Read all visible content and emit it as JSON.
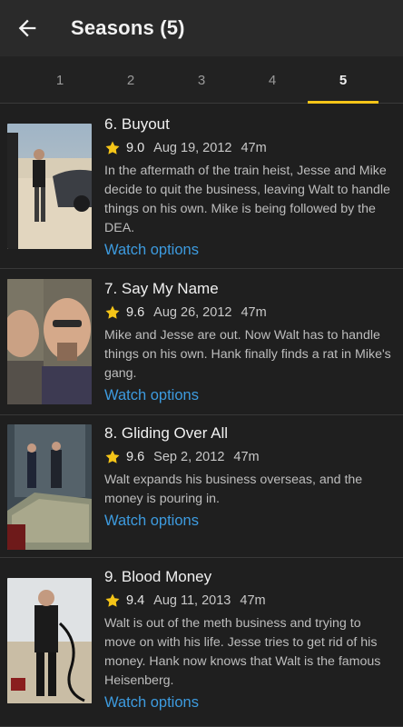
{
  "header": {
    "title": "Seasons (5)"
  },
  "tabs": [
    {
      "label": "1"
    },
    {
      "label": "2"
    },
    {
      "label": "3"
    },
    {
      "label": "4"
    },
    {
      "label": "5"
    }
  ],
  "active_tab": "5",
  "colors": {
    "accent": "#f5c518",
    "link": "#3d9bdf",
    "background": "#1f1f1f"
  },
  "episodes": [
    {
      "title": "6. Buyout",
      "rating": "9.0",
      "date": "Aug 19, 2012",
      "runtime": "47m",
      "description": "In the aftermath of the train heist, Jesse and Mike decide to quit the business, leaving Walt to handle things on his own. Mike is being followed by the DEA.",
      "watch_label": "Watch options"
    },
    {
      "title": "7. Say My Name",
      "rating": "9.6",
      "date": "Aug 26, 2012",
      "runtime": "47m",
      "description": "Mike and Jesse are out. Now Walt has to handle things on his own. Hank finally finds a rat in Mike's gang.",
      "watch_label": "Watch options"
    },
    {
      "title": "8. Gliding Over All",
      "rating": "9.6",
      "date": "Sep 2, 2012",
      "runtime": "47m",
      "description": "Walt expands his business overseas, and the money is pouring in.",
      "watch_label": "Watch options"
    },
    {
      "title": "9. Blood Money",
      "rating": "9.4",
      "date": "Aug 11, 2013",
      "runtime": "47m",
      "description": "Walt is out of the meth business and trying to move on with his life. Jesse tries to get rid of his money. Hank now knows that Walt is the famous Heisenberg.",
      "watch_label": "Watch options"
    }
  ]
}
